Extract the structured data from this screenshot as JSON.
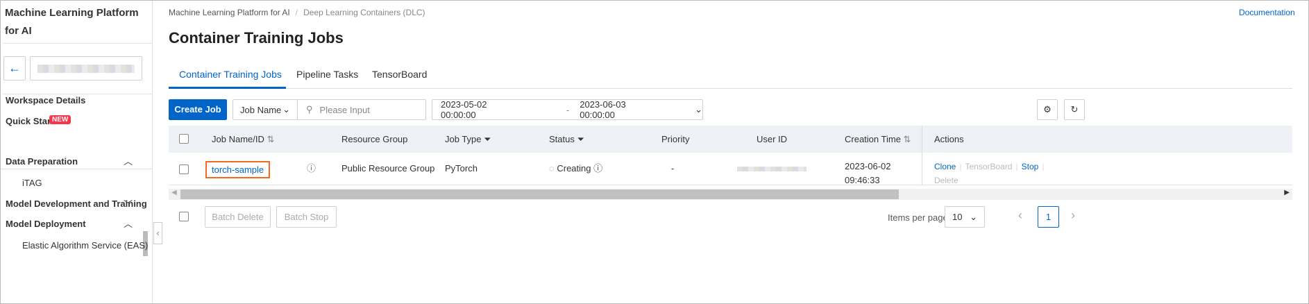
{
  "sidebar": {
    "title": "Machine Learning Platform for AI",
    "items": [
      {
        "label": "Workspace Details"
      },
      {
        "label": "Quick Start",
        "badge": "NEW"
      }
    ],
    "groups": [
      {
        "label": "Data Preparation",
        "children": [
          "iTAG"
        ]
      },
      {
        "label": "Model Development and Training"
      },
      {
        "label": "Model Deployment",
        "children": [
          "Elastic Algorithm Service (EAS)"
        ]
      }
    ]
  },
  "breadcrumb": [
    "Machine Learning Platform for AI",
    "Deep Learning Containers (DLC)"
  ],
  "documentation": "Documentation",
  "page_title": "Container Training Jobs",
  "tabs": [
    "Container Training Jobs",
    "Pipeline Tasks",
    "TensorBoard"
  ],
  "toolbar": {
    "create": "Create Job",
    "filter_field": "Job Name",
    "search_placeholder": "Please Input",
    "date_start": "2023-05-02 00:00:00",
    "date_sep": "-",
    "date_end": "2023-06-03 00:00:00"
  },
  "table": {
    "headers": [
      "Job Name/ID",
      "Resource Group",
      "Job Type",
      "Status",
      "Priority",
      "User ID",
      "Creation Time",
      "Actions"
    ],
    "rows": [
      {
        "name": "torch-sample",
        "resource_group": "Public Resource Group",
        "job_type": "PyTorch",
        "status": "Creating",
        "priority": "-",
        "date": "2023-06-02",
        "time": "09:46:33",
        "actions": [
          "Clone",
          "TensorBoard",
          "Stop",
          "Delete"
        ]
      }
    ]
  },
  "footer": {
    "batch_delete": "Batch Delete",
    "batch_stop": "Batch Stop",
    "items_per_page_label": "Items per page:",
    "items_per_page": "10",
    "page": "1"
  }
}
